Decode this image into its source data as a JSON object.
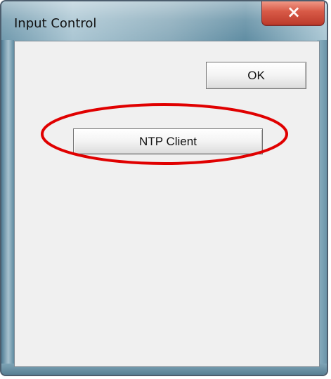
{
  "window": {
    "title": "Input Control",
    "close_icon": "close-icon",
    "close_label": "×"
  },
  "buttons": {
    "ok_label": "OK",
    "ntp_client_label": "NTP Client"
  },
  "annotations": {
    "highlight_color": "#e00000"
  },
  "icons": {
    "close": "close-icon"
  }
}
